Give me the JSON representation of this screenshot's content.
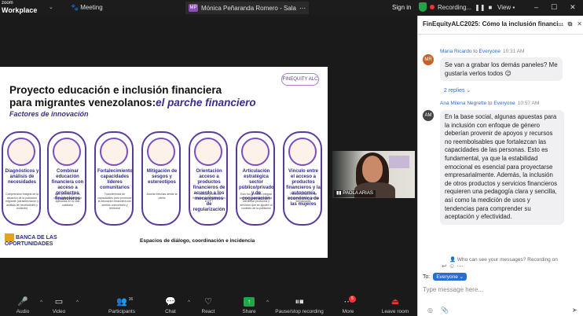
{
  "topbar": {
    "app_small": "zoom",
    "app_big": "Workplace",
    "meeting_label": "Meeting",
    "host_initials": "MP",
    "host_name": "Mónica Peñaranda Romero - Sala",
    "sign_in": "Sign in",
    "recording": "Recording...",
    "view": "View"
  },
  "slide": {
    "title_line1": "Proyecto educación e inclusión financiera",
    "title_line2_plain": "para migrantes venezolanos:",
    "title_line2_accent": "el parche financiero",
    "subtitle": "Factores de innovación",
    "brand": "FINEQUITY ALC",
    "pillars": [
      {
        "title": "Diagnósticos y análisis de necesidades",
        "desc": "Comprensión integral de la situación de la población migrante (caracterización y análisis de necesidades y contexto)"
      },
      {
        "title": "Combinar educación financiera con acceso a productos financieros",
        "desc": "Esto permite que los conocimientos se vean aplicados en la vida cotidiana"
      },
      {
        "title": "Fortalecimiento capacidades líderes comunitarios",
        "desc": "Transferencia de capacidades para promover la educación financiera con sentido comunitario y territorial"
      },
      {
        "title": "Mitigación de sesgos y estereotipos",
        "desc": "Acortar brechas desde la oferta"
      },
      {
        "title": "Orientación acceso a productos financieros de acuerdo a los mecanismos de regularización",
        "desc": "Portafolio productos financieros habilitados con el PPT"
      },
      {
        "title": "Articulación estratégica sector público/privado y de cooperación",
        "desc": "Esto ha permitido integrar servicios complementarios, identificar productos y servicios que se ajusten al contexto de la población"
      },
      {
        "title": "Vínculo entre el acceso a productos financieros y la autonomía económica de las mujeres",
        "desc": "Transversalización del enfoque de género en las formaciones"
      }
    ],
    "spaces": "Espacios de diálogo, coordinación e incidencia",
    "banco_line1": "BANCA DE LAS",
    "banco_line2": "OPORTUNIDADES"
  },
  "video": {
    "name": "PAOLA ARIAS"
  },
  "toolbar": {
    "items": [
      {
        "label": "Audio",
        "icon": "microphone-muted-icon"
      },
      {
        "label": "Video",
        "icon": "camera-off-icon"
      },
      {
        "label": "Participants",
        "icon": "participants-icon",
        "count": "36"
      },
      {
        "label": "Chat",
        "icon": "chat-icon"
      },
      {
        "label": "React",
        "icon": "heart-icon"
      },
      {
        "label": "Share",
        "icon": "share-icon"
      },
      {
        "label": "Pause/stop recording",
        "icon": "pause-stop-icon"
      },
      {
        "label": "More",
        "icon": "more-icon",
        "badge": "5"
      },
      {
        "label": "Leave room",
        "icon": "leave-icon"
      }
    ]
  },
  "chat": {
    "title": "FinEquityALC2025: Cómo la inclusión financi...",
    "messages": [
      {
        "initials": "MR",
        "avatar_color": "#c8602c",
        "sender": "Maria Ricardo",
        "to": "to",
        "recipient": "Everyone",
        "time": "10:31 AM",
        "text": "Se van a grabar los demás paneles? Me gustaría verlos todos 😉",
        "replies": "2 replies"
      },
      {
        "initials": "AM",
        "avatar_color": "#444444",
        "sender": "Ana Milena Negrette",
        "to": "to",
        "recipient": "Everyone",
        "time": "10:57 AM",
        "text": "En la base social, algunas apuestas para la inclusión con enfoque de género deberían provenir de apoyos y recursos no reembolsables que fortalezcan las capacidades de las personas. Esto es fundamental, ya que la estabilidad emocional es esencial para proyectarse empresarialmente. Además, la inclusión de otros productos y servicios financieros requieren una pedagogía clara y sencilla, así como la medición de usos y tendencias para comprender su aceptación y efectividad."
      }
    ],
    "privacy": "Who can see your messages? Recording on",
    "to_label": "To:",
    "to_value": "Everyone",
    "placeholder": "Type message here..."
  }
}
